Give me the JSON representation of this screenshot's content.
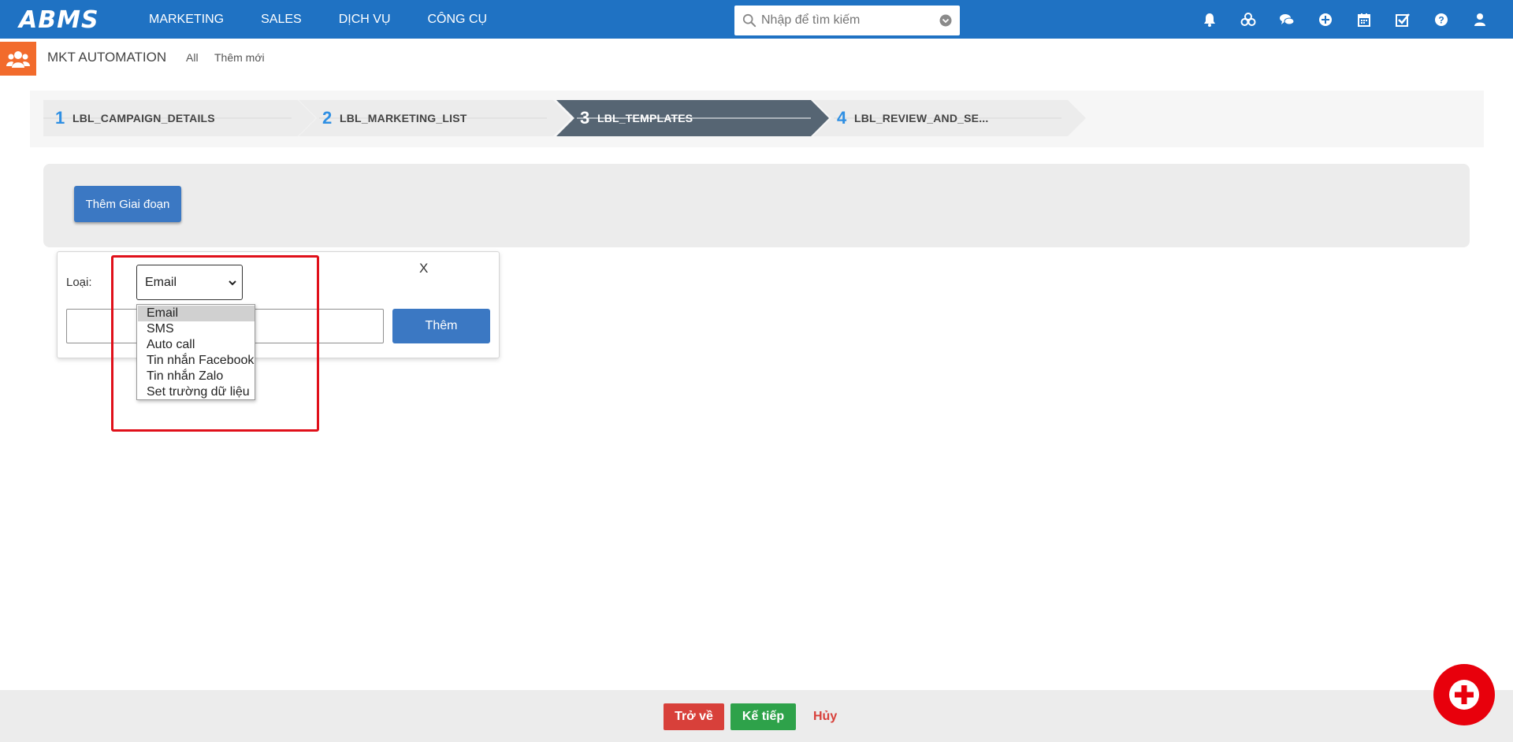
{
  "brand": {
    "logo_text": "ABMS",
    "accent": "#1f72c3"
  },
  "nav": {
    "items": [
      {
        "label": "MARKETING"
      },
      {
        "label": "SALES"
      },
      {
        "label": "DỊCH VỤ"
      },
      {
        "label": "CÔNG CỤ"
      }
    ]
  },
  "search": {
    "placeholder": "Nhập để tìm kiếm",
    "icon": "search-icon"
  },
  "top_icons": [
    "bell-icon",
    "cubes-icon",
    "chat-icon",
    "plus-circle-icon",
    "calendar-icon",
    "checkbox-icon",
    "help-icon",
    "user-icon"
  ],
  "module": {
    "title": "MKT AUTOMATION",
    "links": {
      "all": "All",
      "new": "Thêm mới"
    },
    "badge_color": "#f26b2c"
  },
  "wizard": {
    "steps": [
      {
        "number": "1",
        "label": "LBL_CAMPAIGN_DETAILS",
        "active": false
      },
      {
        "number": "2",
        "label": "LBL_MARKETING_LIST",
        "active": false
      },
      {
        "number": "3",
        "label": "LBL_TEMPLATES",
        "active": true
      },
      {
        "number": "4",
        "label": "LBL_REVIEW_AND_SE...",
        "active": false
      }
    ],
    "active_color": "#566573"
  },
  "stage": {
    "add_button": "Thêm Giai đoạn"
  },
  "popup": {
    "close_label": "X",
    "type_label": "Loại:",
    "type_selected": "Email",
    "type_options": [
      "Email",
      "SMS",
      "Auto call",
      "Tin nhắn Facebook",
      "Tin nhắn Zalo",
      "Set trường dữ liệu"
    ],
    "name_value": "",
    "add_button": "Thêm"
  },
  "footer": {
    "back": "Trở về",
    "next": "Kế tiếp",
    "cancel": "Hủy"
  },
  "colors": {
    "danger": "#d8403a",
    "success": "#2ea24a",
    "highlight": "#e0101a",
    "fab": "#e8000c"
  }
}
